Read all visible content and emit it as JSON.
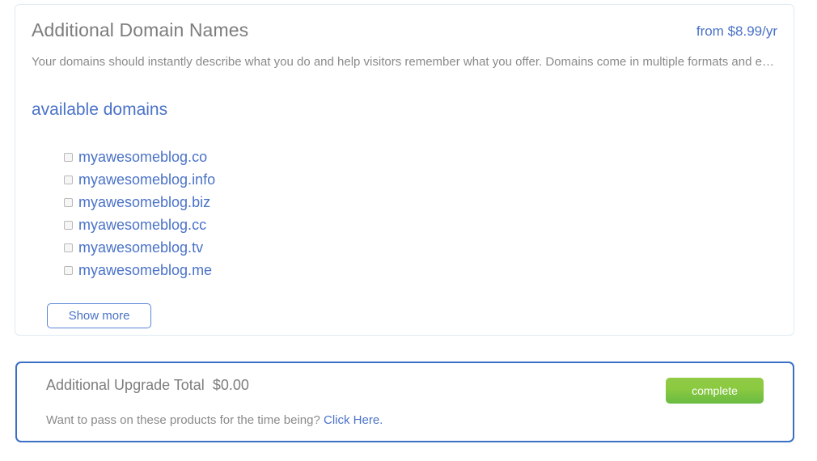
{
  "domains_panel": {
    "title": "Additional Domain Names",
    "price": "from $8.99/yr",
    "description": "Your domains should instantly describe what you do and help visitors remember what you offer. Domains come in multiple formats and extensions.",
    "section_heading": "available domains",
    "show_more_label": "Show more",
    "available_domains": [
      {
        "name": "myawesomeblog.co",
        "checked": false
      },
      {
        "name": "myawesomeblog.info",
        "checked": false
      },
      {
        "name": "myawesomeblog.biz",
        "checked": false
      },
      {
        "name": "myawesomeblog.cc",
        "checked": false
      },
      {
        "name": "myawesomeblog.tv",
        "checked": false
      },
      {
        "name": "myawesomeblog.me",
        "checked": false
      }
    ]
  },
  "total_panel": {
    "total_label": "Additional Upgrade Total",
    "total_amount": "$0.00",
    "pass_on_text": "Want to pass on these products for the time being?",
    "pass_on_link": "Click Here.",
    "complete_label": "complete"
  },
  "colors": {
    "link_blue": "#4a72c8",
    "panel_border_blue": "#3a6fc4",
    "panel_border_light": "#dfeaf2",
    "text_gray": "#7d7d7d",
    "muted_gray": "#8a8a8a",
    "complete_green_top": "#92cb46",
    "complete_green_bottom": "#69bb43"
  }
}
